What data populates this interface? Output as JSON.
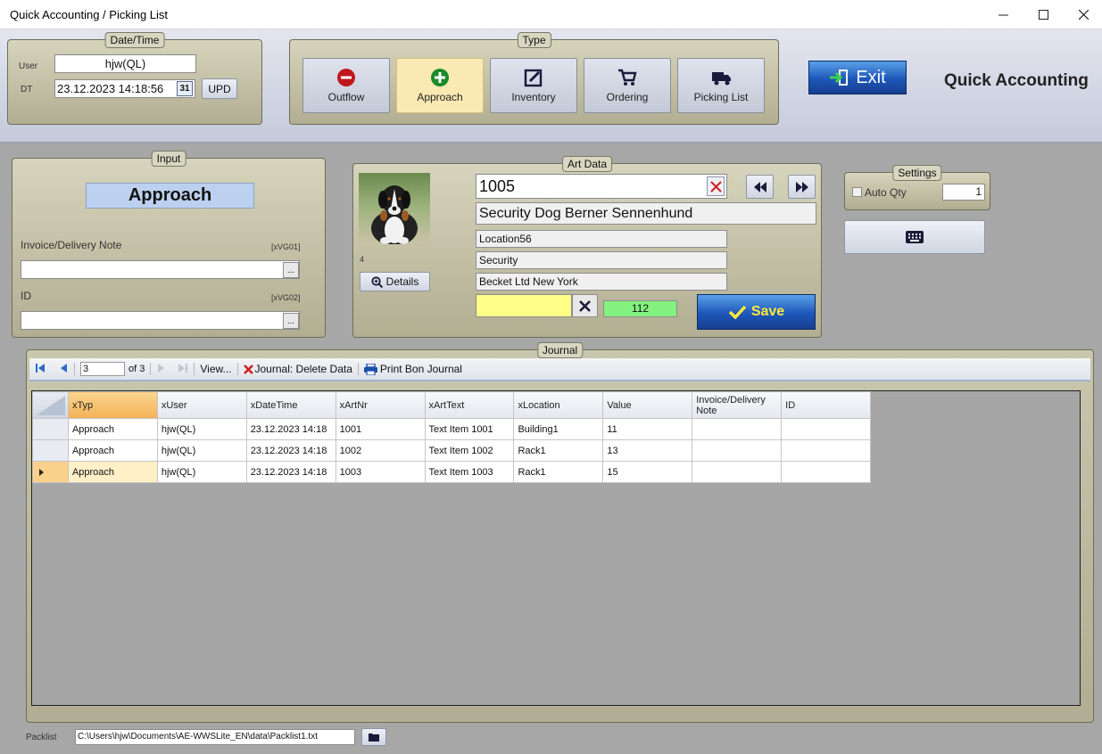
{
  "window": {
    "title": "Quick Accounting / Picking List"
  },
  "datetime": {
    "label": "Date/Time",
    "user_label": "User",
    "user_value": "hjw(QL)",
    "dt_label": "DT",
    "dt_value": "23.12.2023 14:18:56",
    "calendar_label": "31",
    "upd_label": "UPD"
  },
  "type": {
    "label": "Type",
    "buttons": [
      {
        "label": "Outflow",
        "icon": "minus-circle-icon",
        "color": "#c0171d"
      },
      {
        "label": "Approach",
        "icon": "plus-circle-icon",
        "color": "#1b8a2a"
      },
      {
        "label": "Inventory",
        "icon": "edit-square-icon",
        "color": "#1a1a3a"
      },
      {
        "label": "Ordering",
        "icon": "cart-icon",
        "color": "#1a1a3a"
      },
      {
        "label": "Picking List",
        "icon": "truck-icon",
        "color": "#1a1a3a"
      }
    ],
    "active_index": 1
  },
  "exit_label": "Exit",
  "brand": "Quick Accounting",
  "input": {
    "label": "Input",
    "mode": "Approach",
    "invoice_label": "Invoice/Delivery Note",
    "invoice_code": "[xVG01]",
    "invoice_value": "",
    "id_label": "ID",
    "id_code": "[xVG02]",
    "id_value": "",
    "ellipsis": "..."
  },
  "art": {
    "label": "Art Data",
    "number": "1005",
    "name": "Security Dog Berner Sennenhund",
    "location": "Location56",
    "category": "Security",
    "supplier": "Becket Ltd New York",
    "qty_value": "",
    "stock": "112",
    "image_index": "4",
    "details_label": "Details",
    "save_label": "Save"
  },
  "settings": {
    "label": "Settings",
    "auto_qty_label": "Auto Qty",
    "auto_qty_checked": false,
    "qty_default": "1"
  },
  "journal": {
    "label": "Journal",
    "nav": {
      "current": "3",
      "of_text": "of 3",
      "view_label": "View...",
      "delete_label": "Journal: Delete Data",
      "print_label": "Print Bon Journal"
    },
    "columns": [
      "xTyp",
      "xUser",
      "xDateTime",
      "xArtNr",
      "xArtText",
      "xLocation",
      "Value",
      "Invoice/Delivery Note",
      "ID"
    ],
    "rows": [
      [
        "Approach",
        "hjw(QL)",
        "23.12.2023 14:18",
        "1001",
        "Text Item 1001",
        "Building1",
        "11",
        "",
        ""
      ],
      [
        "Approach",
        "hjw(QL)",
        "23.12.2023 14:18",
        "1002",
        "Text Item 1002",
        "Rack1",
        "13",
        "",
        ""
      ],
      [
        "Approach",
        "hjw(QL)",
        "23.12.2023 14:18",
        "1003",
        "Text Item 1003",
        "Rack1",
        "15",
        "",
        ""
      ]
    ],
    "current_row": 2
  },
  "packlist": {
    "label": "Packlist",
    "path": "C:\\Users\\hjw\\Documents\\AE-WWSLite_EN\\data\\Packlist1.txt"
  }
}
